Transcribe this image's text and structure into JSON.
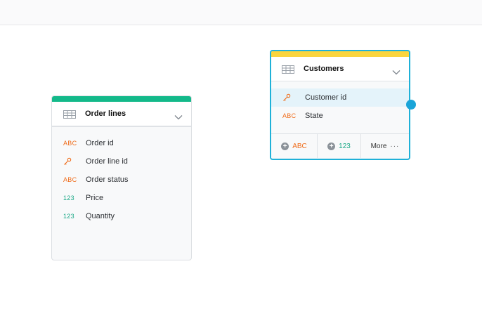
{
  "colors": {
    "order_lines_accent": "#13b98a",
    "customers_accent": "#fad53e",
    "selection_border": "#1fb1d8",
    "text_type_color": "#ef6c1a",
    "number_type_color": "#1aa886"
  },
  "order_lines": {
    "title": "Order lines",
    "icon": "table-icon",
    "fields": [
      {
        "type": "ABC",
        "name": "Order id"
      },
      {
        "type": "key",
        "name": "Order line id"
      },
      {
        "type": "ABC",
        "name": "Order status"
      },
      {
        "type": "123",
        "name": "Price"
      },
      {
        "type": "123",
        "name": "Quantity"
      }
    ]
  },
  "customers": {
    "title": "Customers",
    "icon": "table-icon",
    "fields": [
      {
        "type": "key",
        "name": "Customer id",
        "selected": true
      },
      {
        "type": "ABC",
        "name": "State"
      }
    ],
    "footer": {
      "add_text_label": "ABC",
      "add_number_label": "123",
      "more_label": "More",
      "more_icon": "ellipsis-icon"
    }
  }
}
